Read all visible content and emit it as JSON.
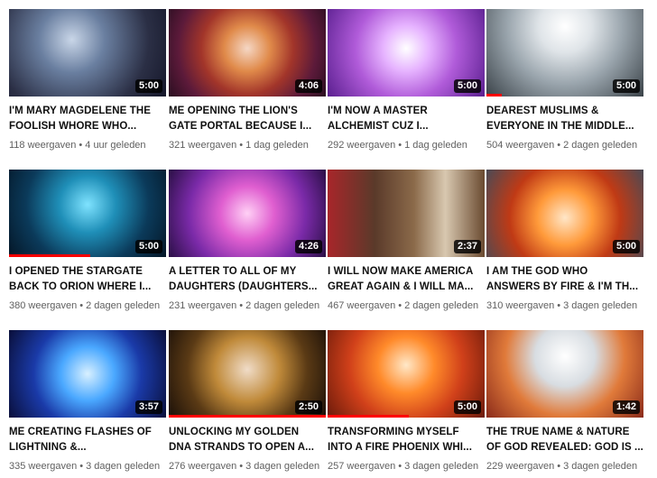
{
  "accent_color": "#ff0000",
  "videos": [
    {
      "title_line1": "I'M MARY MAGDELENE THE",
      "title_line2": "FOOLISH WHORE WHO...",
      "duration": "5:00",
      "views": "118 weergaven",
      "age": "4 uur geleden",
      "watched_fraction": 0
    },
    {
      "title_line1": "ME OPENING THE LION'S",
      "title_line2": "GATE PORTAL BECAUSE I...",
      "duration": "4:06",
      "views": "321 weergaven",
      "age": "1 dag geleden",
      "watched_fraction": 0
    },
    {
      "title_line1": "I'M NOW A MASTER",
      "title_line2": "ALCHEMIST CUZ I...",
      "duration": "5:00",
      "views": "292 weergaven",
      "age": "1 dag geleden",
      "watched_fraction": 0
    },
    {
      "title_line1": "DEAREST MUSLIMS &",
      "title_line2": "EVERYONE IN THE MIDDLE...",
      "duration": "5:00",
      "views": "504 weergaven",
      "age": "2 dagen geleden",
      "watched_fraction": 0.1
    },
    {
      "title_line1": "I OPENED THE STARGATE",
      "title_line2": "BACK TO ORION WHERE I...",
      "duration": "5:00",
      "views": "380 weergaven",
      "age": "2 dagen geleden",
      "watched_fraction": 0.52
    },
    {
      "title_line1": "A LETTER TO ALL OF MY",
      "title_line2": "DAUGHTERS (DAUGHTERS...",
      "duration": "4:26",
      "views": "231 weergaven",
      "age": "2 dagen geleden",
      "watched_fraction": 0
    },
    {
      "title_line1": "I WILL NOW MAKE AMERICA",
      "title_line2": "GREAT AGAIN & I WILL MA...",
      "duration": "2:37",
      "views": "467 weergaven",
      "age": "2 dagen geleden",
      "watched_fraction": 0
    },
    {
      "title_line1": "I AM THE GOD WHO",
      "title_line2": "ANSWERS BY FIRE & I'M TH...",
      "duration": "5:00",
      "views": "310 weergaven",
      "age": "3 dagen geleden",
      "watched_fraction": 0
    },
    {
      "title_line1": "ME CREATING FLASHES OF",
      "title_line2": "LIGHTNING &...",
      "duration": "3:57",
      "views": "335 weergaven",
      "age": "3 dagen geleden",
      "watched_fraction": 0
    },
    {
      "title_line1": "UNLOCKING MY GOLDEN",
      "title_line2": "DNA STRANDS TO OPEN A...",
      "duration": "2:50",
      "views": "276 weergaven",
      "age": "3 dagen geleden",
      "watched_fraction": 1.0
    },
    {
      "title_line1": "TRANSFORMING MYSELF",
      "title_line2": "INTO A FIRE PHOENIX WHI...",
      "duration": "5:00",
      "views": "257 weergaven",
      "age": "3 dagen geleden",
      "watched_fraction": 0.52
    },
    {
      "title_line1": "THE TRUE NAME & NATURE",
      "title_line2": "OF GOD REVEALED: GOD IS ...",
      "duration": "1:42",
      "views": "229 weergaven",
      "age": "3 dagen geleden",
      "watched_fraction": 0
    }
  ]
}
